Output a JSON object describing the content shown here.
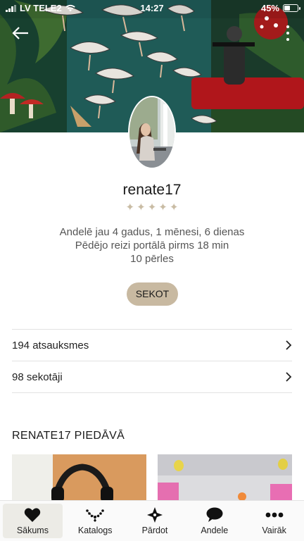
{
  "status_bar": {
    "carrier": "LV TELE2",
    "time": "14:27",
    "battery": "45%"
  },
  "header": {
    "back_icon": "arrow-left-icon",
    "menu_icon": "more-vertical-icon"
  },
  "profile": {
    "username": "renate17",
    "rating_stars": 5,
    "info_lines": [
      "Andelē jau 4 gadus, 1 mēnesi, 6 dienas",
      "Pēdējo reizi portālā pirms 18 min",
      "10 pērles"
    ],
    "follow_label": "SEKOT"
  },
  "list": {
    "reviews_label": "194 atsauksmes",
    "followers_label": "98 sekotāji"
  },
  "offers": {
    "title": "RENATE17 PIEDĀVĀ"
  },
  "nav": {
    "items": [
      {
        "label": "Sākums",
        "icon": "heart-icon",
        "active": true
      },
      {
        "label": "Katalogs",
        "icon": "necklace-icon",
        "active": false
      },
      {
        "label": "Pārdot",
        "icon": "diamond-star-icon",
        "active": false
      },
      {
        "label": "Andele",
        "icon": "chat-bubble-icon",
        "active": false
      },
      {
        "label": "Vairāk",
        "icon": "more-horizontal-icon",
        "active": false
      }
    ]
  },
  "colors": {
    "accent": "#c8b9a1",
    "star": "#c9bca4",
    "cover_teal": "#1f5f5a"
  }
}
